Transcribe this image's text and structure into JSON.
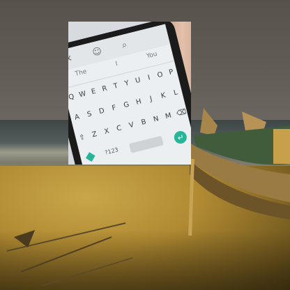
{
  "image": {
    "description_colors": {
      "sky": "#5a554f",
      "sand": "#b08a32",
      "accent_key": "#27b59a"
    }
  },
  "keyboard": {
    "suggestions": [
      "The",
      "I",
      "You"
    ],
    "row1": [
      "Q",
      "W",
      "E",
      "R",
      "T",
      "Y",
      "U",
      "I",
      "O",
      "P"
    ],
    "row2": [
      "A",
      "S",
      "D",
      "F",
      "G",
      "H",
      "J",
      "K",
      "L"
    ],
    "row3": [
      "Z",
      "X",
      "C",
      "V",
      "B",
      "N",
      "M"
    ],
    "numbers_key": "?123"
  }
}
